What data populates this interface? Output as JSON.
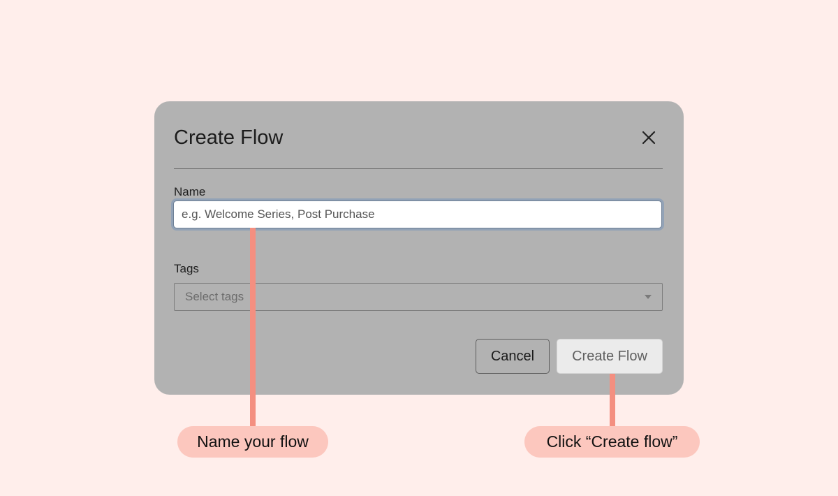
{
  "modal": {
    "title": "Create Flow",
    "close_icon": "close-icon",
    "name_field": {
      "label": "Name",
      "value": "",
      "placeholder": "e.g. Welcome Series, Post Purchase"
    },
    "tags_field": {
      "label": "Tags",
      "placeholder": "Select tags",
      "dropdown_icon": "chevron-down-icon"
    },
    "buttons": {
      "cancel_label": "Cancel",
      "create_label": "Create Flow"
    }
  },
  "callouts": {
    "name_your_flow": "Name your flow",
    "click_create_flow": "Click “Create flow”"
  },
  "colors": {
    "page_background": "#ffeeeb",
    "modal_background": "#b2b2b2",
    "callout_background": "#fcc7be",
    "connector": "#f48f80"
  }
}
